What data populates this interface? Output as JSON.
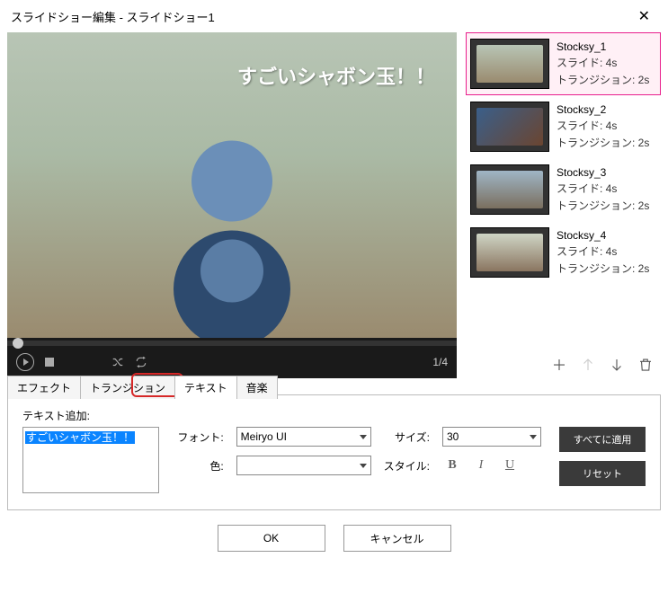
{
  "window": {
    "title": "スライドショー編集  -  スライドショー1"
  },
  "preview": {
    "overlay_text": "すごいシャボン玉！！",
    "counter": "1/4"
  },
  "slides": [
    {
      "name": "Stocksy_1",
      "slide": "スライド: 4s",
      "transition": "トランジション: 2s"
    },
    {
      "name": "Stocksy_2",
      "slide": "スライド: 4s",
      "transition": "トランジション: 2s"
    },
    {
      "name": "Stocksy_3",
      "slide": "スライド: 4s",
      "transition": "トランジション: 2s"
    },
    {
      "name": "Stocksy_4",
      "slide": "スライド: 4s",
      "transition": "トランジション: 2s"
    }
  ],
  "tabs": {
    "effect": "エフェクト",
    "transition": "トランジション",
    "text": "テキスト",
    "music": "音楽"
  },
  "text_panel": {
    "add_label": "テキスト追加:",
    "input_value": "すごいシャボン玉！！",
    "font_label": "フォント:",
    "font_value": "Meiryo UI",
    "size_label": "サイズ:",
    "size_value": "30",
    "color_label": "色:",
    "style_label": "スタイル:",
    "style_b": "B",
    "style_i": "I",
    "style_u": "U",
    "apply_all": "すべてに適用",
    "reset": "リセット"
  },
  "footer": {
    "ok": "OK",
    "cancel": "キャンセル"
  },
  "colors": {
    "accent": "#e91e8c",
    "highlight": "#d62828"
  }
}
